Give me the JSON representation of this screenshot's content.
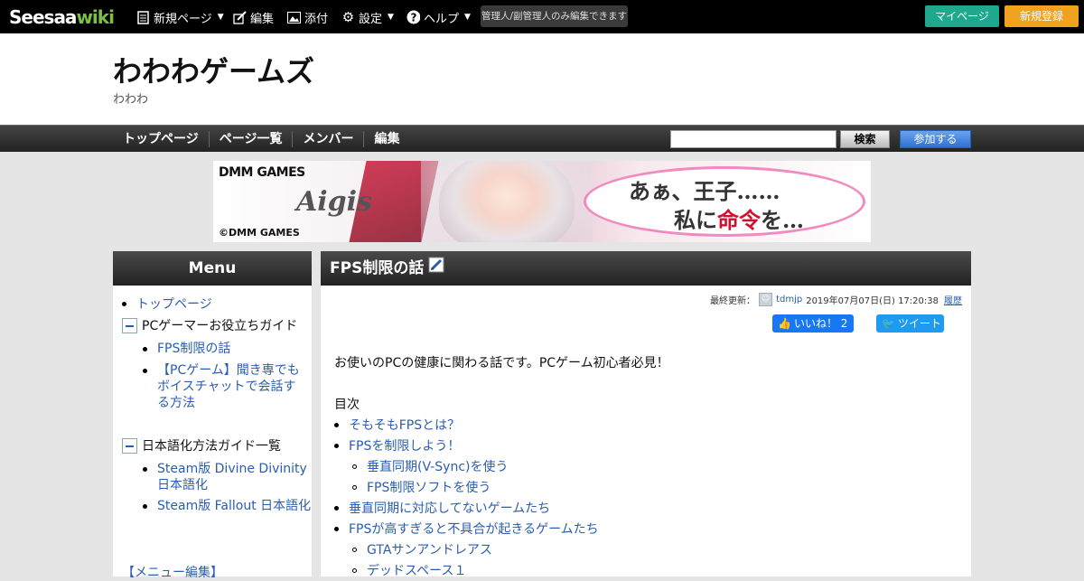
{
  "topbar": {
    "logo_seesaa": "Seesaa",
    "logo_wiki": "wiki",
    "new_page": "新規ページ",
    "edit": "編集",
    "attach": "添付",
    "settings": "設定",
    "help": "ヘルプ",
    "notice": "管理人/副管理人のみ編集できます",
    "mypage": "マイページ",
    "register": "新規登録"
  },
  "header": {
    "title": "わわわゲームズ",
    "subtitle": "わわわ"
  },
  "gnav": {
    "items": [
      "トップページ",
      "ページ一覧",
      "メンバー",
      "編集"
    ],
    "search_button": "検索",
    "join_button": "参加する"
  },
  "banner": {
    "brand": "DMM GAMES",
    "game": "Aigis",
    "copyright": "©DMM GAMES",
    "line1": "あぁ、王子……",
    "line2_prefix": "私に",
    "line2_red": "命令",
    "line2_suffix": "を…"
  },
  "sidebar": {
    "title": "Menu",
    "top_link": "トップページ",
    "cat1": "PCゲーマーお役立ちガイド",
    "cat1_items": [
      "FPS制限の話",
      "【PCゲーム】聞き専でも",
      "ボイスチャットで会話す",
      "る方法"
    ],
    "cat2": "日本語化方法ガイド一覧",
    "cat2_items": [
      "Steam版 Divine Divinity",
      "日本語化",
      "Steam版 Fallout 日本語化"
    ],
    "edit_link": "【メニュー編集】"
  },
  "article": {
    "title": "FPS制限の話",
    "updated_label": "最終更新：",
    "author": "tdmjp",
    "updated_at": "2019年07月07日(日) 17:20:38",
    "history": "履歴",
    "like_label": "いいね！ 2",
    "tweet_label": "ツイート",
    "intro": "お使いのPCの健康に関わる話です。PCゲーム初心者必見！",
    "toc_title": "目次",
    "toc": [
      "そもそもFPSとは？",
      "FPSを制限しよう！",
      "垂直同期(V-Sync)を使う",
      "FPS制限ソフトを使う",
      "垂直同期に対応してないゲームたち",
      "FPSが高すぎると不具合が起きるゲームたち",
      "GTAサンアンドレアス",
      "デッドスペース１"
    ]
  }
}
